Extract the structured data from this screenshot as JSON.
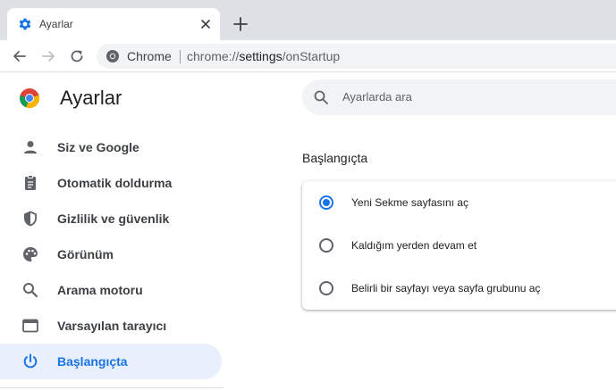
{
  "tab": {
    "title": "Ayarlar",
    "icon": "gear-icon",
    "close_icon": "close-icon"
  },
  "toolbar": {
    "back_icon": "back-arrow-icon",
    "forward_icon": "forward-arrow-icon",
    "reload_icon": "reload-icon",
    "omnibox": {
      "host": "Chrome",
      "url_scheme": "chrome://",
      "url_path": "settings",
      "url_rest": "/onStartup"
    }
  },
  "header": {
    "title": "Ayarlar",
    "logo": "chrome-logo"
  },
  "search": {
    "placeholder": "Ayarlarda ara",
    "icon": "search-icon"
  },
  "sidebar": {
    "items": [
      {
        "label": "Siz ve Google",
        "icon": "person-icon"
      },
      {
        "label": "Otomatik doldurma",
        "icon": "clipboard-icon"
      },
      {
        "label": "Gizlilik ve güvenlik",
        "icon": "shield-icon"
      },
      {
        "label": "Görünüm",
        "icon": "palette-icon"
      },
      {
        "label": "Arama motoru",
        "icon": "search-icon"
      },
      {
        "label": "Varsayılan tarayıcı",
        "icon": "browser-window-icon"
      },
      {
        "label": "Başlangıçta",
        "icon": "power-icon",
        "active": true
      }
    ]
  },
  "main": {
    "section_title": "Başlangıçta",
    "options": [
      {
        "label": "Yeni Sekme sayfasını aç",
        "checked": true
      },
      {
        "label": "Kaldığım yerden devam et",
        "checked": false
      },
      {
        "label": "Belirli bir sayfayı veya sayfa grubunu aç",
        "checked": false
      }
    ]
  },
  "colors": {
    "accent": "#1a73e8",
    "active_bg": "#e8f0fe",
    "tabstrip": "#dee1e6"
  }
}
